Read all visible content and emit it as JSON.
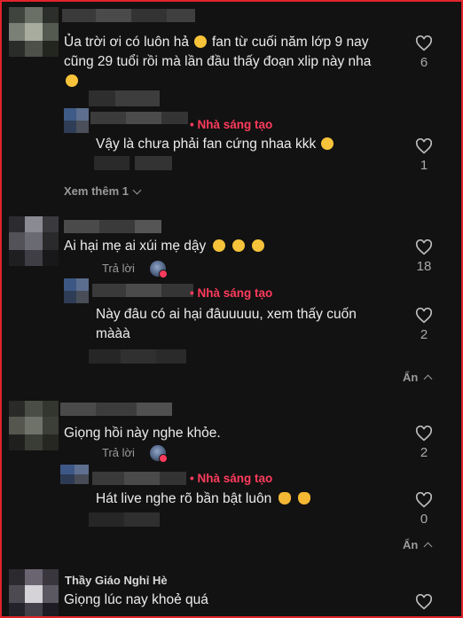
{
  "labels": {
    "creator": "Nhà sáng tạo",
    "reply": "Trả lời",
    "view_more": "Xem thêm 1",
    "hide": "Ẩn"
  },
  "comments": [
    {
      "text_line1": "Ủa trời ơi có luôn hả",
      "text_line1b": "fan từ cuối năm lớp 9 nay",
      "text_line2": "cũng 29 tuổi rồi mà lần đầu thấy đoạn xlip này nha",
      "likes": "6",
      "reply": {
        "text": "Vậy là chưa phải fan cứng nhaa kkk",
        "likes": "1"
      }
    },
    {
      "text": "Ai hại mẹ ai xúi mẹ dậy",
      "likes": "18",
      "reply": {
        "text_line1": "Này đâu có ai hại đâuuuuu, xem thấy cuốn",
        "text_line2": "mààà",
        "likes": "2"
      }
    },
    {
      "text": "Giọng hồi này nghe khỏe.",
      "likes": "2",
      "reply": {
        "text": "Hát live nghe rõ bần bật luôn",
        "likes": "0"
      }
    },
    {
      "username": "Thầy Giáo Nghỉ Hè",
      "text": "Giọng lúc nay khoẻ quá"
    }
  ],
  "colors": {
    "background": "#121212",
    "creator": "#ff3b5c",
    "frame_border": "#e0242a"
  }
}
